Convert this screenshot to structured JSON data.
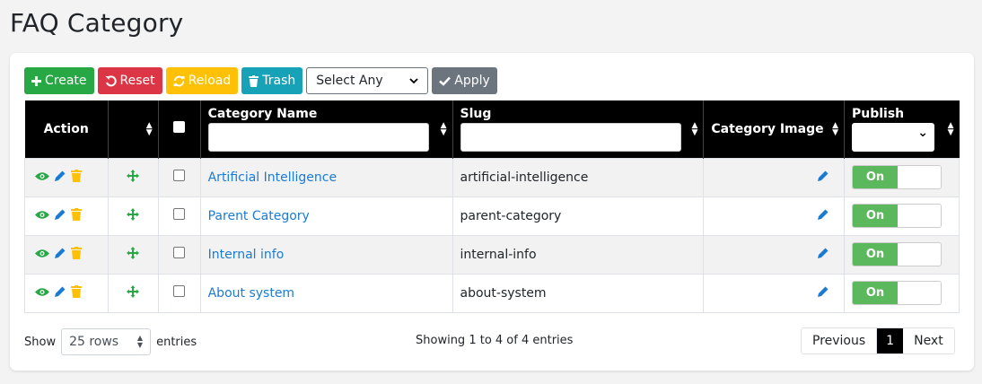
{
  "page": {
    "title": "FAQ Category"
  },
  "toolbar": {
    "create_label": "Create",
    "reset_label": "Reset",
    "reload_label": "Reload",
    "trash_label": "Trash",
    "bulk_select_value": "Select Any",
    "apply_label": "Apply"
  },
  "table": {
    "headers": {
      "action": "Action",
      "category_name": "Category Name",
      "slug": "Slug",
      "category_image": "Category Image",
      "publish": "Publish"
    },
    "rows": [
      {
        "name": "Artificial Intelligence",
        "slug": "artificial-intelligence",
        "publish": "On"
      },
      {
        "name": "Parent Category",
        "slug": "parent-category",
        "publish": "On"
      },
      {
        "name": "Internal info",
        "slug": "internal-info",
        "publish": "On"
      },
      {
        "name": "About system",
        "slug": "about-system",
        "publish": "On"
      }
    ]
  },
  "footer": {
    "show_label": "Show",
    "rows_value": "25 rows",
    "entries_label": "entries",
    "info": "Showing 1 to 4 of 4 entries",
    "prev_label": "Previous",
    "page_label": "1",
    "next_label": "Next"
  },
  "colors": {
    "create": "#28a745",
    "reset": "#dc3545",
    "reload": "#ffc107",
    "trash": "#17a2b8",
    "apply": "#6c757d",
    "link": "#1a7bd3",
    "publish_on": "#5cb85c"
  }
}
